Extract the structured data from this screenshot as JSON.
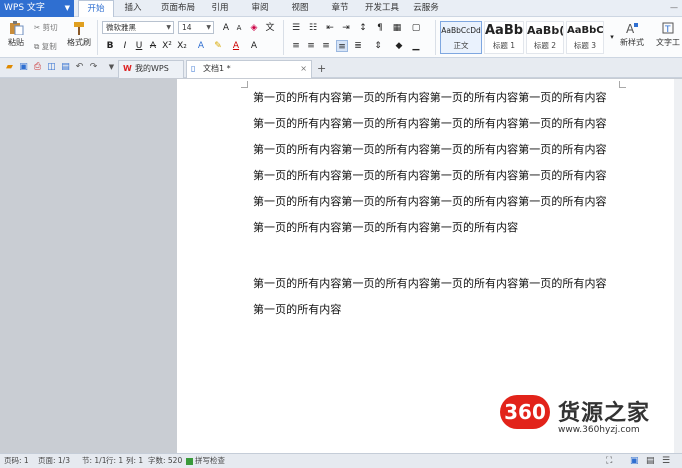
{
  "app": {
    "name": "WPS 文字"
  },
  "menu_tabs": [
    "开始",
    "插入",
    "页面布局",
    "引用",
    "审阅",
    "视图",
    "章节",
    "开发工具",
    "云服务"
  ],
  "ribbon": {
    "paste": "粘贴",
    "cut": "剪切",
    "copy": "复制",
    "format_painter": "格式刷",
    "font_name": "微软雅黑",
    "font_size": "14",
    "styles": [
      {
        "sample": "AaBbCcDd",
        "name": "正文"
      },
      {
        "sample": "AaBb",
        "name": "标题 1"
      },
      {
        "sample": "AaBb(",
        "name": "标题 2"
      },
      {
        "sample": "AaBbC",
        "name": "标题 3"
      }
    ],
    "new_style": "新样式",
    "text_tools": "文字工"
  },
  "doc_tabs": [
    {
      "label": "我的WPS"
    },
    {
      "label": "文档1 *"
    }
  ],
  "document": {
    "para1": "第一页的所有内容第一页的所有内容第一页的所有内容第一页的所有内容第一页的所有内容第一页的所有内容第一页的所有内容第一页的所有内容第一页的所有内容第一页的所有内容第一页的所有内容第一页的所有内容第一页的所有内容第一页的所有内容第一页的所有内容第一页的所有内容第一页的所有内容第一页的所有内容第一页的所有内容第一页的所有内容第一页的所有内容第一页的所有内容第一页的所有内容",
    "para2": "第一页的所有内容第一页的所有内容第一页的所有内容第一页的所有内容第一页的所有内容"
  },
  "status": {
    "page": "页码: 1",
    "pages": "页面: 1/3",
    "section": "节: 1/1",
    "row": "行: 1",
    "col": "列: 1",
    "words": "字数: 520",
    "spell": "拼写检查"
  },
  "watermark": {
    "logo": "360",
    "text": "货源之家",
    "url": "www.360hyzj.com"
  }
}
